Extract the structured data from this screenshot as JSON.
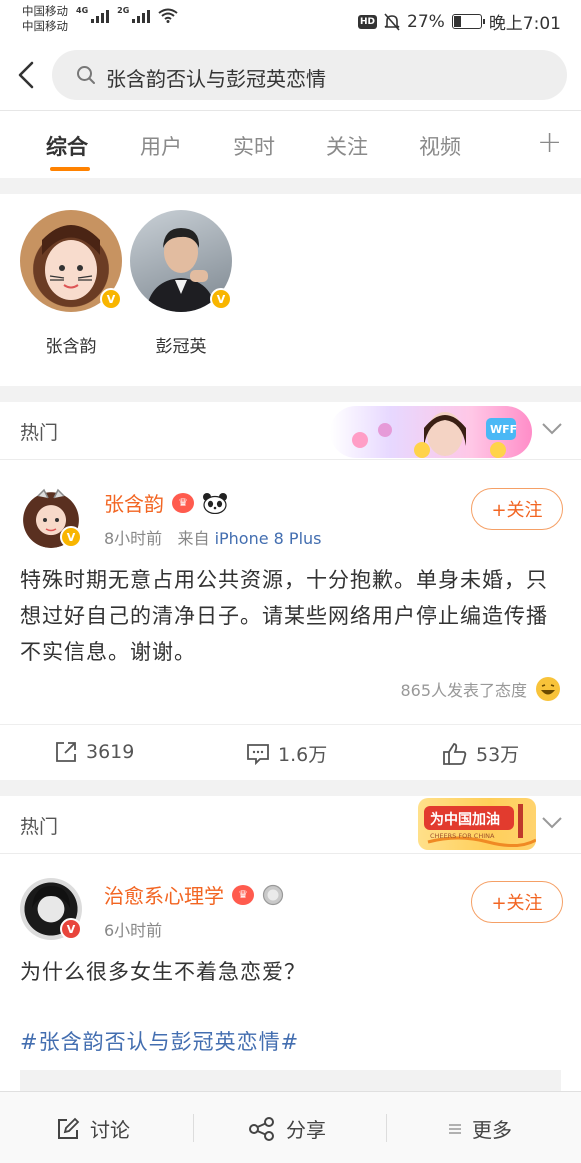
{
  "status_bar": {
    "carrier_1": "中国移动",
    "carrier_2": "中国移动",
    "net_1": "4G",
    "net_2": "2G",
    "hd": "HD",
    "battery": "27%",
    "battery_level": 0.27,
    "time": "晚上7:01"
  },
  "search": {
    "query": "张含韵否认与彭冠英恋情"
  },
  "tabs": [
    {
      "label": "综合",
      "active": true
    },
    {
      "label": "用户"
    },
    {
      "label": "实时"
    },
    {
      "label": "关注"
    },
    {
      "label": "视频"
    }
  ],
  "tabs_more": "+",
  "users": [
    {
      "name": "张含韵",
      "badge": "V"
    },
    {
      "name": "彭冠英",
      "badge": "V"
    }
  ],
  "section_1": {
    "title": "热门",
    "banner_text": "WFF"
  },
  "post_1": {
    "author": "张含韵",
    "badge": "V",
    "crown": "♛",
    "time": "8小时前",
    "from_label": "来自",
    "source": "iPhone 8 Plus",
    "follow": "+关注",
    "text": "特殊时期无意占用公共资源，十分抱歉。单身未婚，只想过好自己的清净日子。请某些网络用户停止编造传播不实信息。谢谢。",
    "attitude": "865人发表了态度",
    "reposts": "3619",
    "comments": "1.6万",
    "likes": "53万"
  },
  "section_2": {
    "title": "热门",
    "banner_title": "为中国加油",
    "banner_sub": "CHEERS FOR CHINA"
  },
  "post_2": {
    "author": "治愈系心理学",
    "badge": "V",
    "crown": "♛",
    "time": "6小时前",
    "follow": "+关注",
    "text": "为什么很多女生不着急恋爱？",
    "hashtag": "#张含韵否认与彭冠英恋情#"
  },
  "bottom_bar": {
    "discuss": "讨论",
    "share": "分享",
    "more": "更多"
  },
  "colors": {
    "accent": "#ff8200",
    "author": "#f26522",
    "link": "#436eb0",
    "verified": "#f8b500"
  }
}
